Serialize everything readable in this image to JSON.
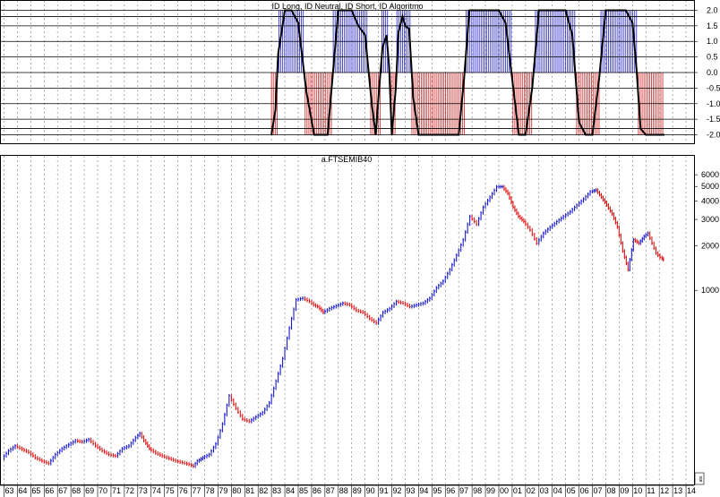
{
  "chart_data": [
    {
      "type": "area",
      "title": "ID Long, ID Neutral, ID Short, ID Algoritmo",
      "ylim": [
        -2.1,
        2.1
      ],
      "yticks": [
        2.0,
        1.5,
        1.0,
        0.5,
        0.0,
        -0.5,
        -1.0,
        -1.5,
        -2.0
      ],
      "ytick_labels": [
        "2.0",
        "1.5",
        "1.0",
        "0.5",
        "0.0",
        "-0.5",
        "-1.0",
        "-1.5",
        "-2.0"
      ],
      "hlines": [
        2.0,
        1.8,
        1.5,
        1.0,
        0.5,
        0.0,
        -0.5,
        -1.0,
        -1.5,
        -1.8,
        -2.0
      ],
      "grid": true,
      "colors": {
        "long": "#2222cc",
        "neutral": "#888888",
        "short": "#cc2222",
        "algoritmo": "#000000"
      },
      "series": [
        {
          "name": "ID Algoritmo",
          "x": [
            1983.0,
            1983.3,
            1983.5,
            1984.0,
            1984.5,
            1985.0,
            1985.6,
            1986.2,
            1986.8,
            1987.2,
            1987.5,
            1988.0,
            1988.5,
            1989.0,
            1989.5,
            1990.0,
            1990.5,
            1990.8,
            1991.0,
            1991.3,
            1991.6,
            1991.8,
            1992.0,
            1992.3,
            1992.5,
            1992.8,
            1993.0,
            1993.3,
            1993.6,
            1994.0,
            1994.4,
            1994.8,
            1995.2,
            1995.6,
            1996.0,
            1996.5,
            1997.0,
            1997.4,
            1997.8,
            1998.2,
            1998.6,
            1999.0,
            1999.5,
            2000.0,
            2000.5,
            2001.0,
            2001.5,
            2002.0,
            2002.5,
            2003.0,
            2003.5,
            2004.0,
            2004.5,
            2005.0,
            2005.5,
            2006.0,
            2006.5,
            2007.0,
            2007.5,
            2008.0,
            2008.5,
            2009.0,
            2009.5,
            2010.0,
            2010.3,
            2010.6,
            2011.0,
            2011.5,
            2012.0,
            2012.4
          ],
          "y": [
            -2.0,
            -1.2,
            0.6,
            2.0,
            2.0,
            1.6,
            -0.6,
            -2.0,
            -2.0,
            -2.0,
            -0.5,
            2.0,
            2.0,
            2.0,
            1.5,
            1.2,
            -1.0,
            -2.0,
            -0.8,
            0.8,
            1.2,
            0.2,
            -2.0,
            -0.5,
            1.3,
            1.8,
            1.5,
            1.4,
            -0.8,
            -2.0,
            -2.0,
            -2.0,
            -2.0,
            -2.0,
            -2.0,
            -2.0,
            -2.0,
            -0.2,
            2.0,
            2.0,
            2.0,
            2.0,
            2.0,
            2.0,
            1.6,
            -0.2,
            -2.0,
            -2.0,
            -0.5,
            2.0,
            2.0,
            2.0,
            2.0,
            2.0,
            1.2,
            -1.6,
            -2.0,
            -2.0,
            -0.2,
            2.0,
            2.0,
            2.0,
            2.0,
            1.6,
            0.1,
            -1.8,
            -2.0,
            -2.0,
            -2.0,
            -2.0
          ]
        },
        {
          "name": "ID Long",
          "x": [
            1983.3,
            1984.0,
            1985.0,
            1986.0,
            1988.0,
            1989.0,
            1990.0,
            1991.0,
            1992.0,
            1993.0,
            1994.0,
            1995.0,
            1996.0,
            1997.0,
            1998.0,
            1999.0,
            2000.0,
            2001.0,
            2003.0,
            2004.0,
            2005.0,
            2006.0,
            2009.0,
            2010.0
          ],
          "y": [
            2,
            2,
            2,
            2,
            2,
            2,
            2,
            2,
            1.4,
            1.8,
            0,
            2,
            2,
            2,
            2,
            2,
            2,
            2,
            2,
            2,
            2,
            2,
            2,
            2
          ]
        },
        {
          "name": "ID Short",
          "x": [
            1986.0,
            1987.0,
            1991.0,
            1992.0,
            1994.0,
            1995.0,
            1996.0,
            1997.0,
            2001.0,
            2002.0,
            2007.0,
            2008.0,
            2011.0,
            2012.0
          ],
          "y": [
            -2,
            -2,
            -2,
            -2,
            -2,
            -2,
            -2,
            -2,
            -2,
            -2,
            -2,
            -2,
            -2,
            -2
          ]
        }
      ]
    },
    {
      "type": "line",
      "title": "a.FTSEMIB40",
      "x_tick_labels": [
        "63",
        "64",
        "65",
        "66",
        "67",
        "68",
        "69",
        "70",
        "71",
        "72",
        "73",
        "74",
        "75",
        "76",
        "77",
        "78",
        "79",
        "80",
        "81",
        "82",
        "83",
        "84",
        "85",
        "86",
        "87",
        "88",
        "89",
        "90",
        "91",
        "92",
        "93",
        "94",
        "95",
        "96",
        "97",
        "98",
        "99",
        "00",
        "01",
        "02",
        "03",
        "04",
        "05",
        "06",
        "07",
        "08",
        "09",
        "10",
        "11",
        "12",
        "13",
        "14"
      ],
      "y_scale": "log",
      "ylim": [
        760,
        7000
      ],
      "yticks": [
        6000,
        5000,
        4000,
        3000,
        2000,
        1000
      ],
      "ytick_labels": [
        "6000",
        "5000",
        "4000",
        "3000",
        "2000",
        "1000"
      ],
      "corner_label": "ats",
      "grid": true,
      "colors": {
        "up": "#1a1acc",
        "down": "#dd1111"
      },
      "series": [
        {
          "name": "a.FTSEMIB40",
          "x": [
            1963.0,
            1963.5,
            1964.0,
            1964.5,
            1965.0,
            1965.5,
            1966.0,
            1966.5,
            1967.0,
            1967.5,
            1968.0,
            1968.5,
            1969.0,
            1969.5,
            1970.0,
            1970.5,
            1971.0,
            1971.5,
            1972.0,
            1972.5,
            1973.0,
            1973.3,
            1973.6,
            1974.0,
            1974.5,
            1975.0,
            1975.5,
            1976.0,
            1976.5,
            1977.0,
            1977.3,
            1977.6,
            1978.0,
            1978.5,
            1979.0,
            1979.5,
            1980.0,
            1980.5,
            1981.0,
            1981.5,
            1982.0,
            1982.5,
            1983.0,
            1983.5,
            1984.0,
            1984.5,
            1985.0,
            1985.5,
            1986.0,
            1986.3,
            1986.6,
            1987.0,
            1987.5,
            1988.0,
            1988.5,
            1989.0,
            1989.5,
            1990.0,
            1990.5,
            1991.0,
            1991.5,
            1992.0,
            1992.5,
            1993.0,
            1993.5,
            1994.0,
            1994.5,
            1995.0,
            1995.5,
            1996.0,
            1996.5,
            1997.0,
            1997.5,
            1998.0,
            1998.5,
            1999.0,
            1999.5,
            2000.0,
            2000.4,
            2000.8,
            2001.2,
            2001.6,
            2002.0,
            2002.5,
            2003.0,
            2003.5,
            2004.0,
            2004.5,
            2005.0,
            2005.5,
            2006.0,
            2006.5,
            2007.0,
            2007.4,
            2007.8,
            2008.2,
            2008.6,
            2009.0,
            2009.4,
            2009.8,
            2010.2,
            2010.6,
            2011.0,
            2011.3,
            2011.6,
            2011.9,
            2012.2,
            2012.4
          ],
          "y": [
            85,
            95,
            102,
            97,
            93,
            86,
            82,
            79,
            90,
            98,
            104,
            110,
            108,
            112,
            102,
            95,
            90,
            88,
            98,
            102,
            115,
            122,
            110,
            98,
            92,
            88,
            85,
            82,
            80,
            78,
            76,
            82,
            86,
            90,
            105,
            140,
            210,
            175,
            150,
            145,
            155,
            165,
            190,
            260,
            360,
            560,
            840,
            860,
            820,
            780,
            760,
            700,
            740,
            770,
            800,
            780,
            720,
            700,
            640,
            600,
            700,
            740,
            820,
            800,
            760,
            780,
            800,
            860,
            1000,
            1100,
            1300,
            1600,
            2000,
            2800,
            2500,
            3200,
            3700,
            4300,
            4300,
            3900,
            3200,
            2800,
            2600,
            2300,
            1900,
            2200,
            2400,
            2600,
            2800,
            3000,
            3300,
            3600,
            4000,
            4100,
            3700,
            3300,
            2900,
            2400,
            1700,
            1300,
            2000,
            1900,
            2100,
            2200,
            1900,
            1650,
            1550,
            1500
          ]
        }
      ]
    }
  ]
}
